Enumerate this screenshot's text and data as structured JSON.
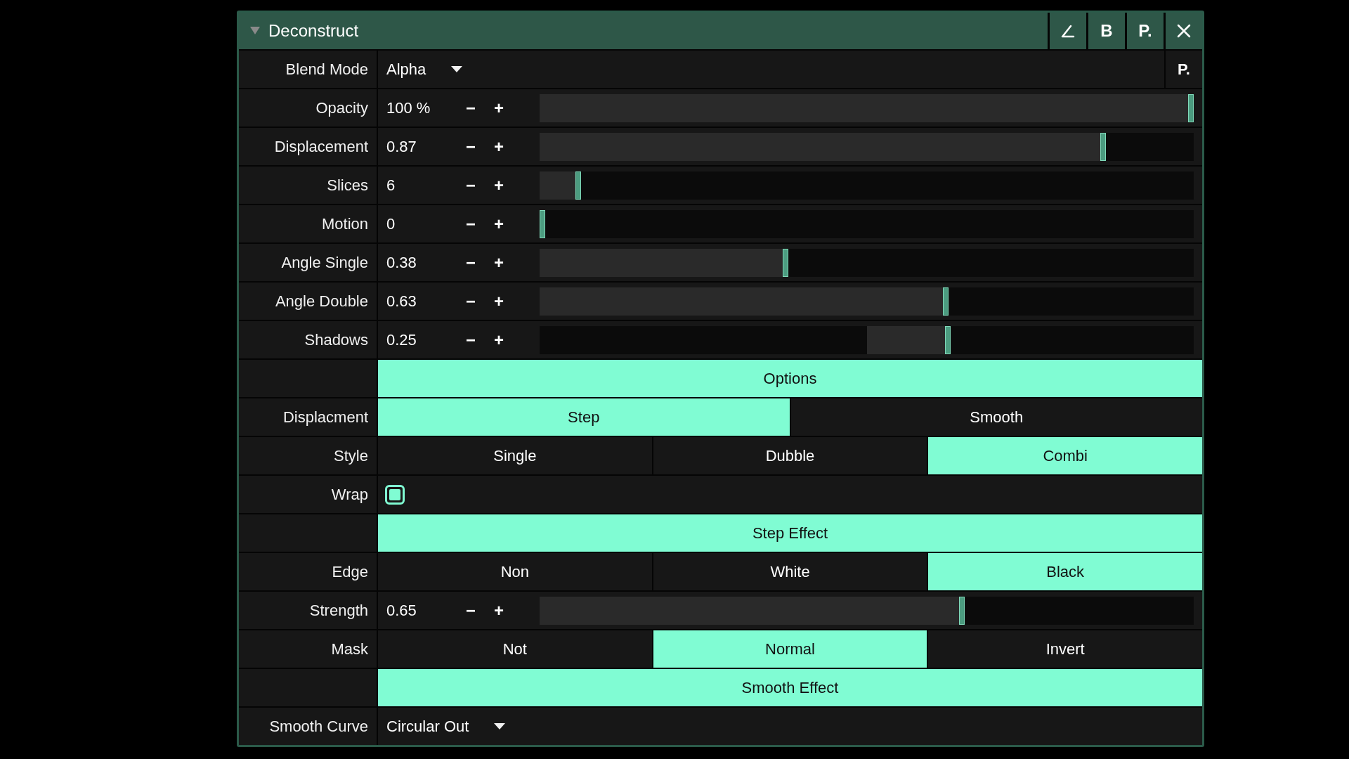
{
  "panel": {
    "title": "Deconstruct",
    "expanded": true,
    "header_buttons": [
      {
        "kind": "angle"
      },
      {
        "kind": "text",
        "label": "B"
      },
      {
        "kind": "text",
        "label": "P."
      },
      {
        "kind": "close"
      }
    ],
    "rows": [
      {
        "kind": "dropdown",
        "label": "Blend Mode",
        "value": "Alpha",
        "extra": "P."
      },
      {
        "kind": "slider",
        "label": "Opacity",
        "value": "100 %",
        "decrement": "−",
        "increment": "+",
        "level": 1,
        "centered": false
      },
      {
        "kind": "slider",
        "label": "Displacement",
        "value": "0.87",
        "decrement": "−",
        "increment": "+",
        "level": 0.865,
        "centered": false
      },
      {
        "kind": "slider",
        "label": "Slices",
        "value": "6",
        "decrement": "−",
        "increment": "+",
        "level": 0.055,
        "centered": false
      },
      {
        "kind": "slider",
        "label": "Motion",
        "value": "0",
        "decrement": "−",
        "increment": "+",
        "level": 0,
        "centered": false
      },
      {
        "kind": "slider",
        "label": "Angle Single",
        "value": "0.38",
        "decrement": "−",
        "increment": "+",
        "level": 0.375,
        "centered": false
      },
      {
        "kind": "slider",
        "label": "Angle Double",
        "value": "0.63",
        "decrement": "−",
        "increment": "+",
        "level": 0.622,
        "centered": false
      },
      {
        "kind": "slider",
        "label": "Shadows",
        "value": "0.25",
        "decrement": "−",
        "increment": "+",
        "level": 0.625,
        "centered": true
      },
      {
        "kind": "section",
        "title": "Options"
      },
      {
        "kind": "choice",
        "label": "Displacment",
        "options": [
          {
            "label": "Step",
            "selected": true
          },
          {
            "label": "Smooth",
            "selected": false
          }
        ]
      },
      {
        "kind": "choice",
        "label": "Style",
        "options": [
          {
            "label": "Single",
            "selected": false
          },
          {
            "label": "Dubble",
            "selected": false
          },
          {
            "label": "Combi",
            "selected": true
          }
        ]
      },
      {
        "kind": "checkbox",
        "label": "Wrap",
        "checked": true
      },
      {
        "kind": "section",
        "title": "Step Effect"
      },
      {
        "kind": "choice",
        "label": "Edge",
        "options": [
          {
            "label": "Non",
            "selected": false
          },
          {
            "label": "White",
            "selected": false
          },
          {
            "label": "Black",
            "selected": true
          }
        ]
      },
      {
        "kind": "slider",
        "label": "Strength",
        "value": "0.65",
        "decrement": "−",
        "increment": "+",
        "level": 0.647,
        "centered": false
      },
      {
        "kind": "choice",
        "label": "Mask",
        "options": [
          {
            "label": "Not",
            "selected": false
          },
          {
            "label": "Normal",
            "selected": true
          },
          {
            "label": "Invert",
            "selected": false
          }
        ]
      },
      {
        "kind": "section",
        "title": "Smooth Effect"
      },
      {
        "kind": "dropdown",
        "label": "Smooth Curve",
        "value": "Circular Out"
      }
    ]
  }
}
